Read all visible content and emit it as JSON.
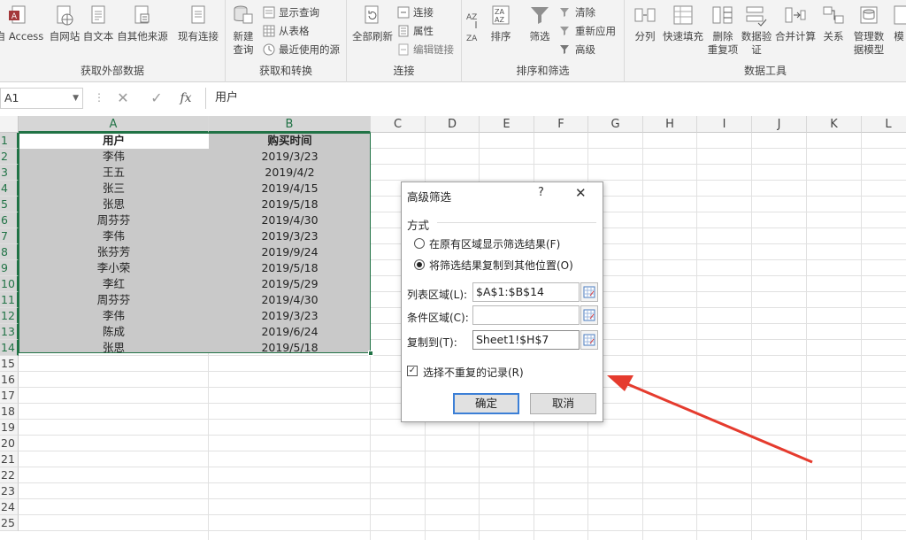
{
  "ribbon": {
    "external_group": {
      "label": "获取外部数据",
      "buttons": [
        "自 Access",
        "自网站",
        "自文本",
        "自其他来源",
        "现有连接"
      ]
    },
    "transform_group": {
      "label": "获取和转换",
      "new_query": "新建\n查询",
      "new_query_line1": "新建",
      "new_query_line2": "查询",
      "items": [
        "显示查询",
        "从表格",
        "最近使用的源"
      ]
    },
    "connections_group": {
      "label": "连接",
      "refresh_all": "全部刷新",
      "items": [
        "连接",
        "属性",
        "编辑链接"
      ]
    },
    "sort_group": {
      "label": "排序和筛选",
      "sort": "排序",
      "filter": "筛选",
      "items": [
        "清除",
        "重新应用",
        "高级"
      ]
    },
    "tools_group": {
      "label": "数据工具",
      "buttons": [
        "分列",
        "快速填充",
        "删除重复项",
        "数据验证",
        "合并计算",
        "关系",
        "管理数据模型",
        "模拟"
      ]
    },
    "tools_labels": {
      "split": "分列",
      "flash": "快速填充",
      "remove_dup_1": "删除",
      "remove_dup_2": "重复项",
      "validate_1": "数据验",
      "validate_2": "证",
      "consolidate": "合并计算",
      "relations": "关系",
      "model_1": "管理数",
      "model_2": "据模型",
      "more": "模"
    }
  },
  "formula_bar": {
    "name_box": "A1",
    "fx": "fx",
    "value": "用户"
  },
  "columns": [
    "A",
    "B",
    "C",
    "D",
    "E",
    "F",
    "G",
    "H",
    "I",
    "J",
    "K",
    "L"
  ],
  "rows": [
    "1",
    "2",
    "3",
    "4",
    "5",
    "6",
    "7",
    "8",
    "9",
    "10",
    "11",
    "12",
    "13",
    "14",
    "15",
    "16",
    "17",
    "18",
    "19",
    "20",
    "21",
    "22",
    "23",
    "24",
    "25"
  ],
  "table": {
    "headers": [
      "用户",
      "购买时间"
    ],
    "rows": [
      [
        "李伟",
        "2019/3/23"
      ],
      [
        "王五",
        "2019/4/2"
      ],
      [
        "张三",
        "2019/4/15"
      ],
      [
        "张思",
        "2019/5/18"
      ],
      [
        "周芬芬",
        "2019/4/30"
      ],
      [
        "李伟",
        "2019/3/23"
      ],
      [
        "张芬芳",
        "2019/9/24"
      ],
      [
        "李小荣",
        "2019/5/18"
      ],
      [
        "李红",
        "2019/5/29"
      ],
      [
        "周芬芬",
        "2019/4/30"
      ],
      [
        "李伟",
        "2019/3/23"
      ],
      [
        "陈成",
        "2019/6/24"
      ],
      [
        "张思",
        "2019/5/18"
      ]
    ]
  },
  "dialog": {
    "title": "高级筛选",
    "help": "?",
    "close": "✕",
    "mode_label": "方式",
    "option_in_place": "在原有区域显示筛选结果(F)",
    "option_copy": "将筛选结果复制到其他位置(O)",
    "list_range_label": "列表区域(L):",
    "list_range_value": "$A$1:$B$14",
    "criteria_label": "条件区域(C):",
    "criteria_value": "",
    "copy_to_label": "复制到(T):",
    "copy_to_value": "Sheet1!$H$7",
    "unique_label": "选择不重复的记录(R)",
    "unique_checked": true,
    "ok": "确定",
    "cancel": "取消"
  },
  "colors": {
    "accent": "#217346",
    "arrow": "#e53b2e",
    "selection": "#c9c9c9"
  }
}
